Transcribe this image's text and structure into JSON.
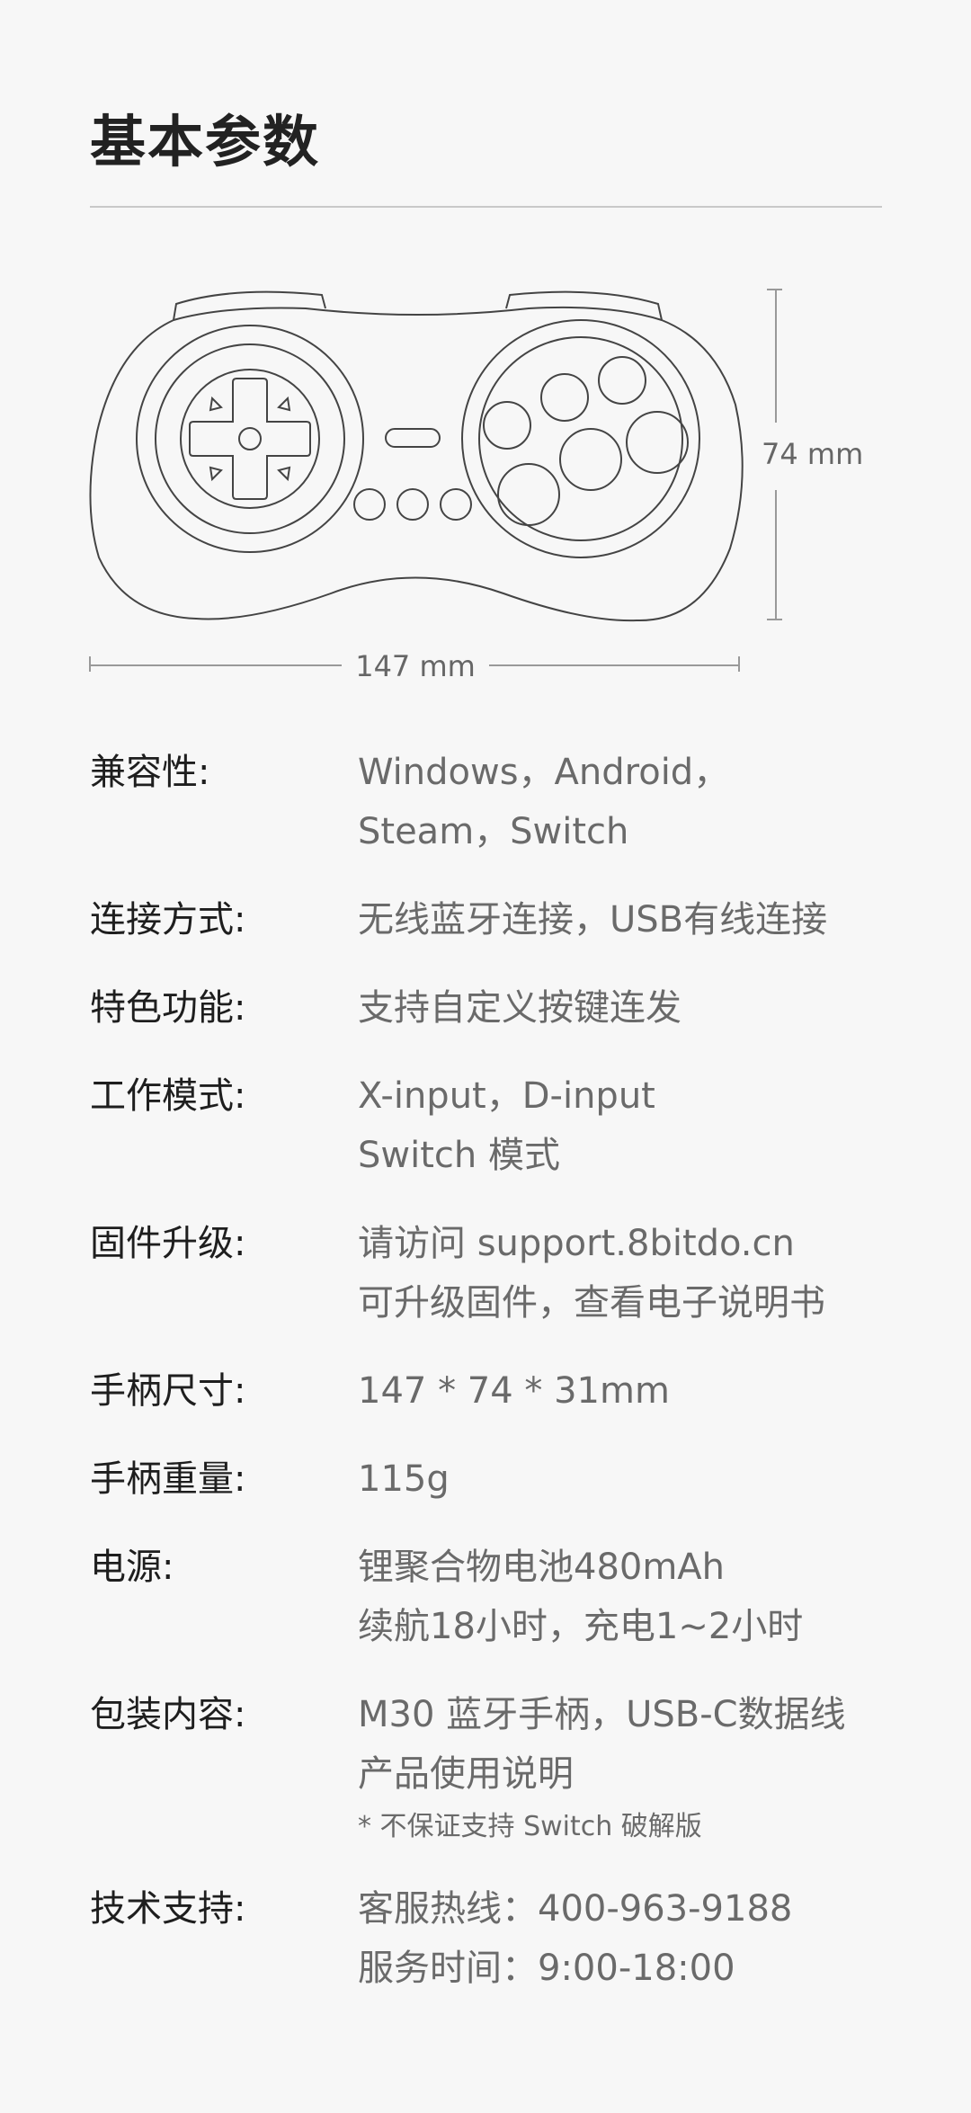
{
  "page": {
    "title": "基本参数"
  },
  "diagram": {
    "height_label": "74 mm",
    "width_label": "147 mm"
  },
  "specs": [
    {
      "label": "兼容性:",
      "lines": [
        "Windows，Android，",
        "Steam，Switch"
      ]
    },
    {
      "label": "连接方式:",
      "lines": [
        "无线蓝牙连接，USB有线连接"
      ]
    },
    {
      "label": "特色功能:",
      "lines": [
        "支持自定义按键连发"
      ]
    },
    {
      "label": "工作模式:",
      "lines": [
        "X-input，D-input",
        "Switch 模式"
      ]
    },
    {
      "label": "固件升级:",
      "lines": [
        "请访问 support.8bitdo.cn",
        "可升级固件，查看电子说明书"
      ]
    },
    {
      "label": "手柄尺寸:",
      "lines": [
        "147 * 74 * 31mm"
      ]
    },
    {
      "label": "手柄重量:",
      "lines": [
        "115g"
      ]
    },
    {
      "label": "电源:",
      "lines": [
        "锂聚合物电池480mAh",
        "续航18小时，充电1~2小时"
      ]
    },
    {
      "label": "包装内容:",
      "lines": [
        "M30 蓝牙手柄，USB-C数据线",
        "产品使用说明"
      ],
      "note": "* 不保证支持 Switch 破解版"
    },
    {
      "label": "技术支持:",
      "lines": [
        "客服热线：400-963-9188",
        "服务时间：9:00-18:00"
      ]
    }
  ]
}
